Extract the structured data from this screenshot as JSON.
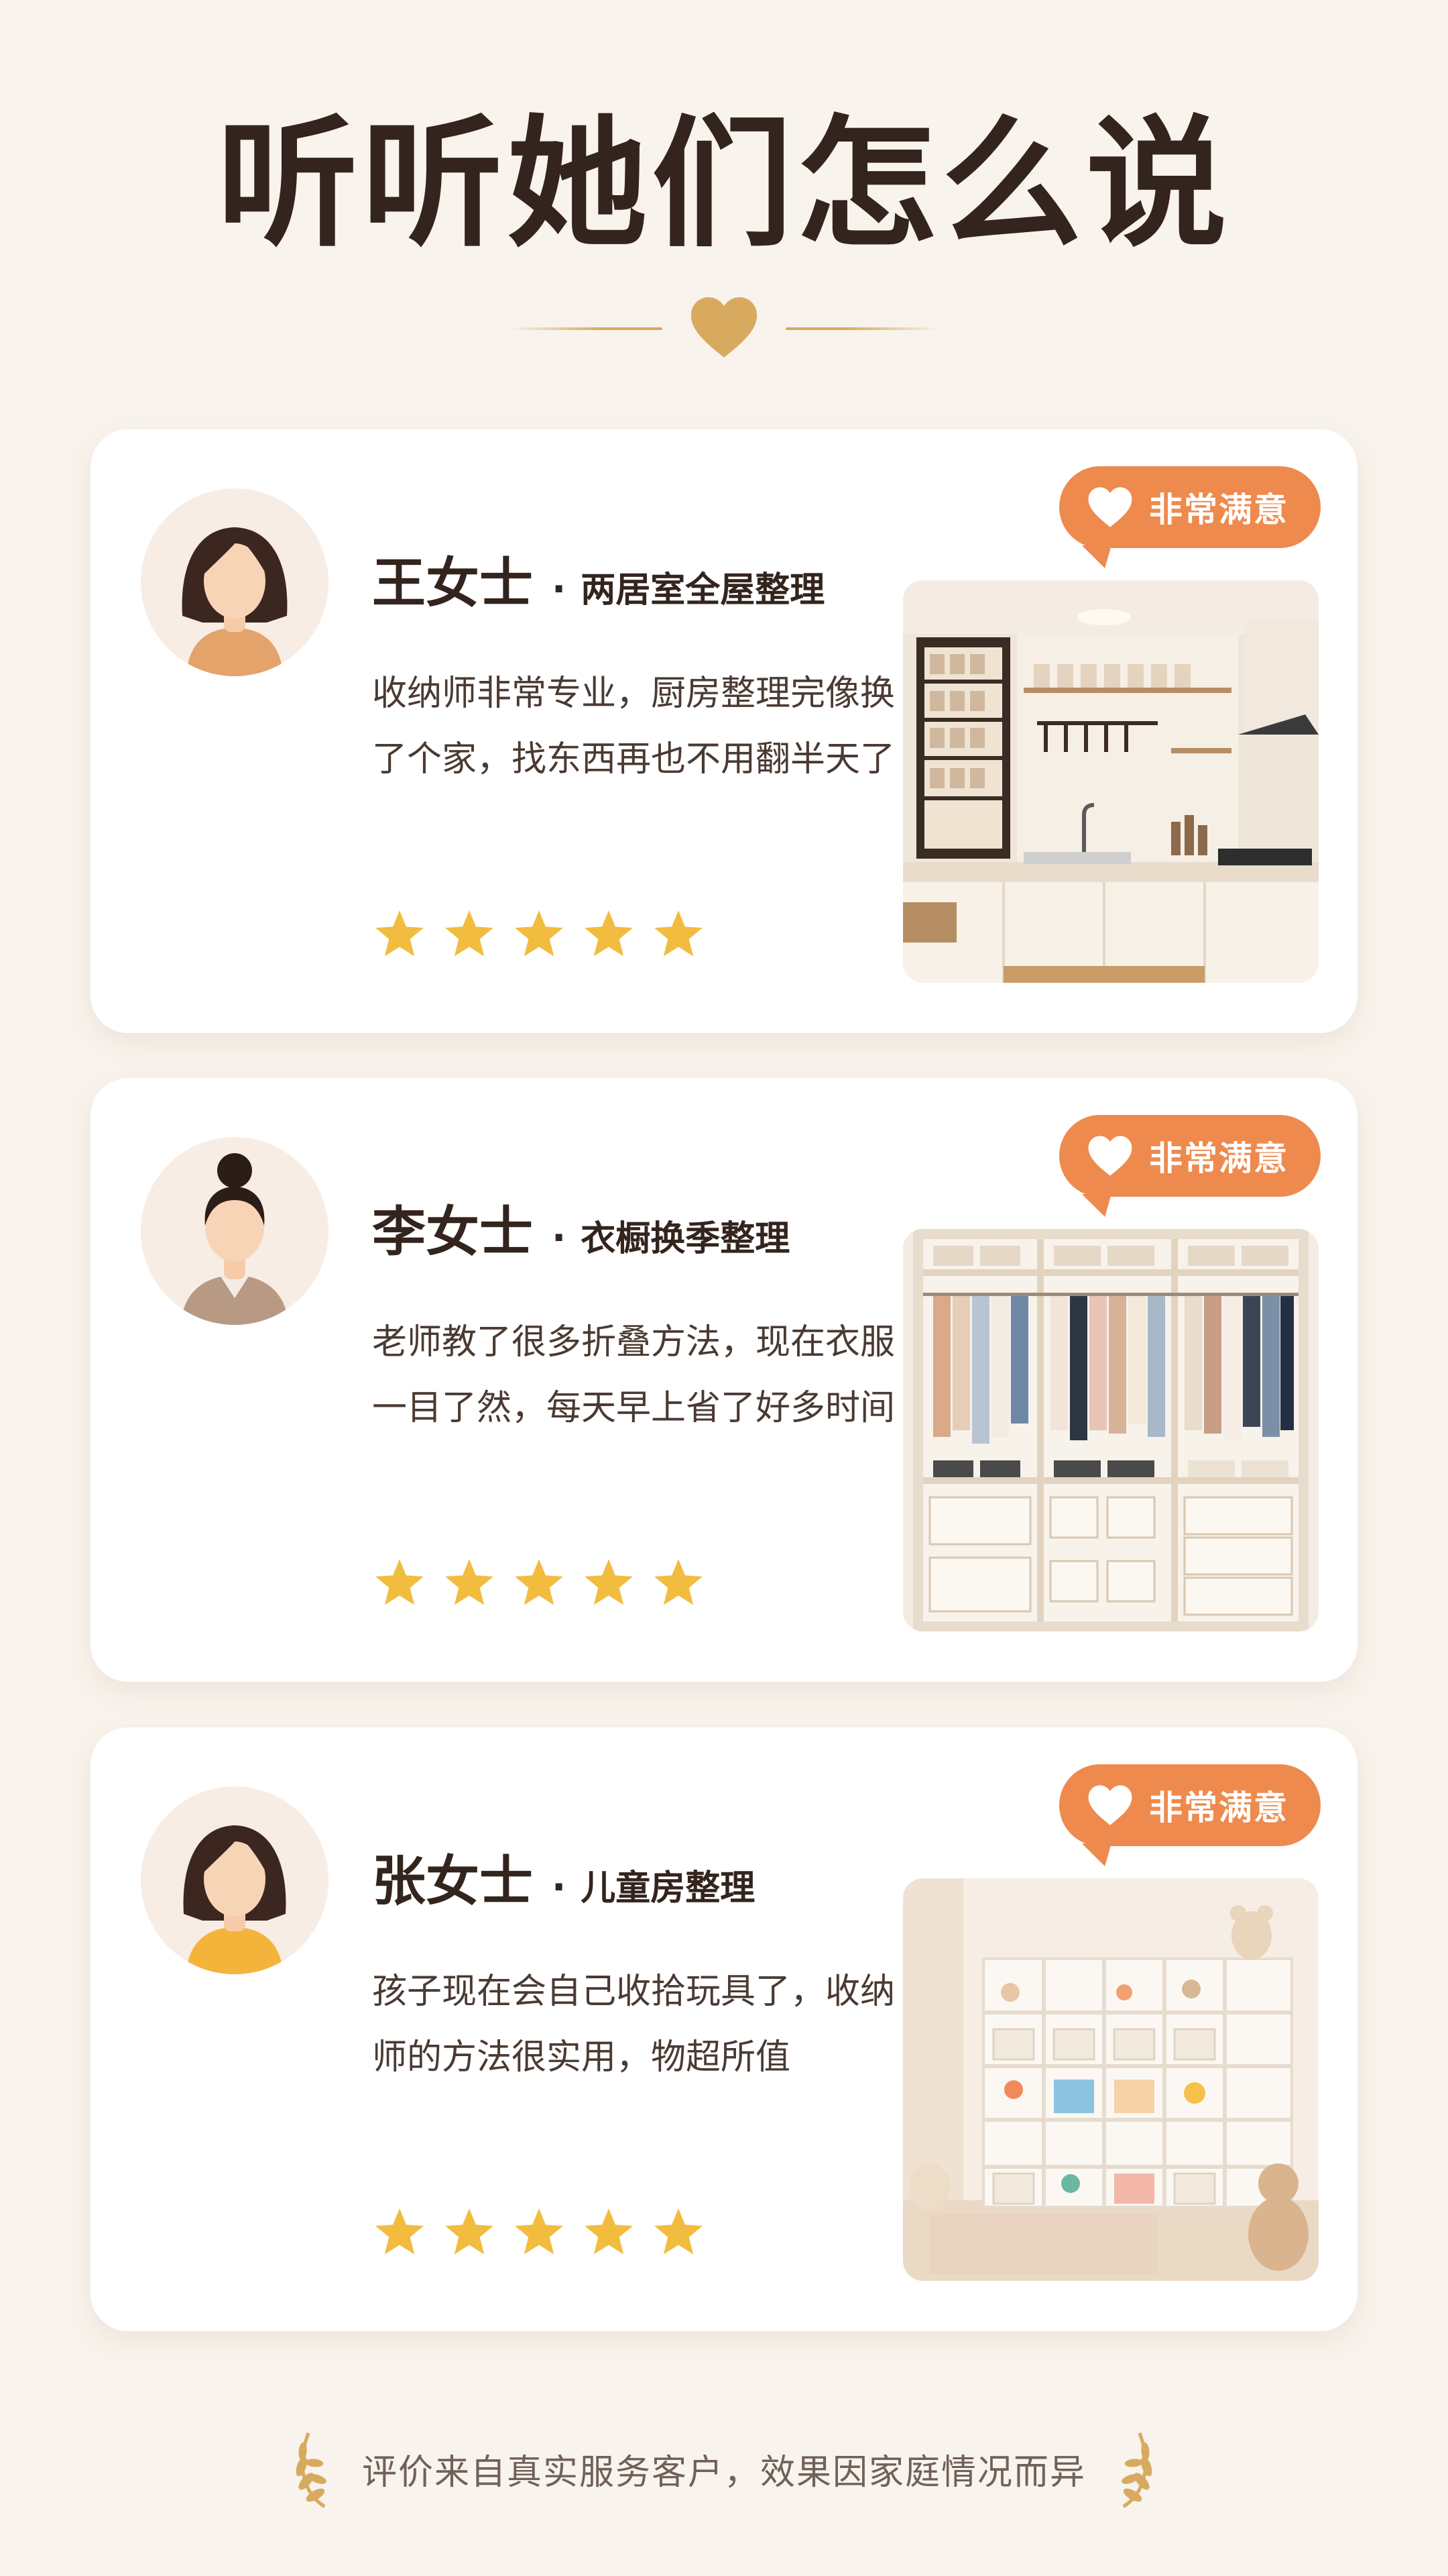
{
  "header": {
    "title": "听听她们怎么说"
  },
  "colors": {
    "background": "#f8f3ec",
    "accent_badge": "#ee8a4e",
    "star": "#f2bc3f",
    "gold": "#d8aa60",
    "title_text": "#33241d"
  },
  "testimonials": [
    {
      "name": "王女士",
      "separator": "·",
      "service": "两居室全屋整理",
      "review": "收纳师非常专业，厨房整理完像换了个家，找东西再也不用翻半天了",
      "rating": 5,
      "badge": "非常满意",
      "photo_icon": "kitchen-photo",
      "avatar_icon": "woman-avatar-icon"
    },
    {
      "name": "李女士",
      "separator": "·",
      "service": "衣橱换季整理",
      "review": "老师教了很多折叠方法，现在衣服一目了然，每天早上省了好多时间",
      "rating": 5,
      "badge": "非常满意",
      "photo_icon": "wardrobe-photo",
      "avatar_icon": "woman-bun-avatar-icon"
    },
    {
      "name": "张女士",
      "separator": "·",
      "service": "儿童房整理",
      "review": "孩子现在会自己收拾玩具了，收纳师的方法很实用，物超所值",
      "rating": 5,
      "badge": "非常满意",
      "photo_icon": "kids-room-photo",
      "avatar_icon": "woman-avatar-icon"
    }
  ],
  "footer": {
    "note": "评价来自真实服务客户，效果因家庭情况而异"
  }
}
